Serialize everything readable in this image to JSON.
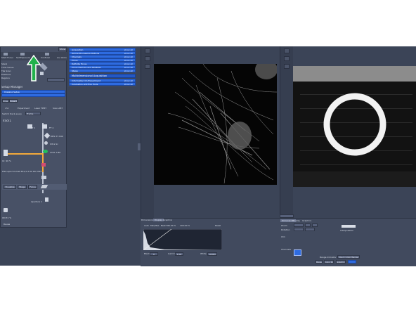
{
  "left_panel": {
    "top_button": "Show",
    "tabs": [
      "Start Focus",
      "Set Exposure",
      "Confocal",
      "Loc Online"
    ],
    "section_rows": [
      "Stack",
      "Time Series",
      "Tile Scan",
      "Positions",
      "Regions"
    ],
    "setup_manager_label": "Setup Manager",
    "imaging_setup_label": "Imaging Setup",
    "mode_tabs": [
      "Smart",
      "Expert"
    ],
    "channel_tabs": [
      "ch1",
      "Experiment",
      "Laser TPMT",
      "Scan-ABT"
    ],
    "switch_track_label": "Switch track every",
    "switch_track_value": "Frame",
    "track_label": "Track1",
    "filter_labels": [
      "FT 1",
      "FT 2",
      "DBS 37.949",
      "Ultra Sc",
      "ChS1 T-80"
    ],
    "laser_label": "Or. 90 %",
    "objective_label": "Plan-Apochromat 63x/1.4 Oil DIC M27",
    "buttons": [
      "Visualize",
      "Stage",
      "Focus"
    ],
    "aperture_label": "Aperture 1",
    "detector_label": "ON 31 %",
    "bottom_label": "Reuse"
  },
  "tools_panel": {
    "rows": [
      {
        "label": "Acquisition",
        "tag": "show all"
      },
      {
        "label": "Online Processing Options",
        "tag": "show all"
      },
      {
        "label": "Channels",
        "tag": "show all"
      },
      {
        "label": "Focus",
        "tag": "show all"
      },
      {
        "label": "Definite Focus",
        "tag": "show all"
      },
      {
        "label": "Focus Devices and Strategy",
        "tag": "show all"
      },
      {
        "label": "Stage",
        "tag": "show all"
      }
    ],
    "group_header": "Multidimensional Acquisition",
    "group_rows": [
      {
        "label": "Information On Experiment",
        "tag": "show all"
      },
      {
        "label": "Incubation and Exp Tools",
        "tag": "show all"
      }
    ]
  },
  "bottom_center": {
    "tabs": [
      "Dimensions",
      "Display",
      "Graphics"
    ],
    "header_labels": [
      "Auto",
      "Min/Max",
      "Best Fit",
      "0.00 %",
      "100.00 %",
      "Reset"
    ],
    "footer_labels": [
      "Black",
      "0",
      "Gamma",
      "1.00",
      "White",
      "16383"
    ]
  },
  "bottom_right": {
    "tabs": [
      "Dimensions",
      "Display",
      "Graphics"
    ],
    "rows": [
      "Zoom",
      "Rotation",
      "Ch1",
      "Channels",
      "Range Indicator",
      "Quick Color Range",
      "Reuse",
      "Copy Roi",
      "Graphics"
    ],
    "right_labels": [
      "Interpolation"
    ]
  },
  "arrow_color": "#22b14c",
  "accent_blue": "#2e6be0"
}
